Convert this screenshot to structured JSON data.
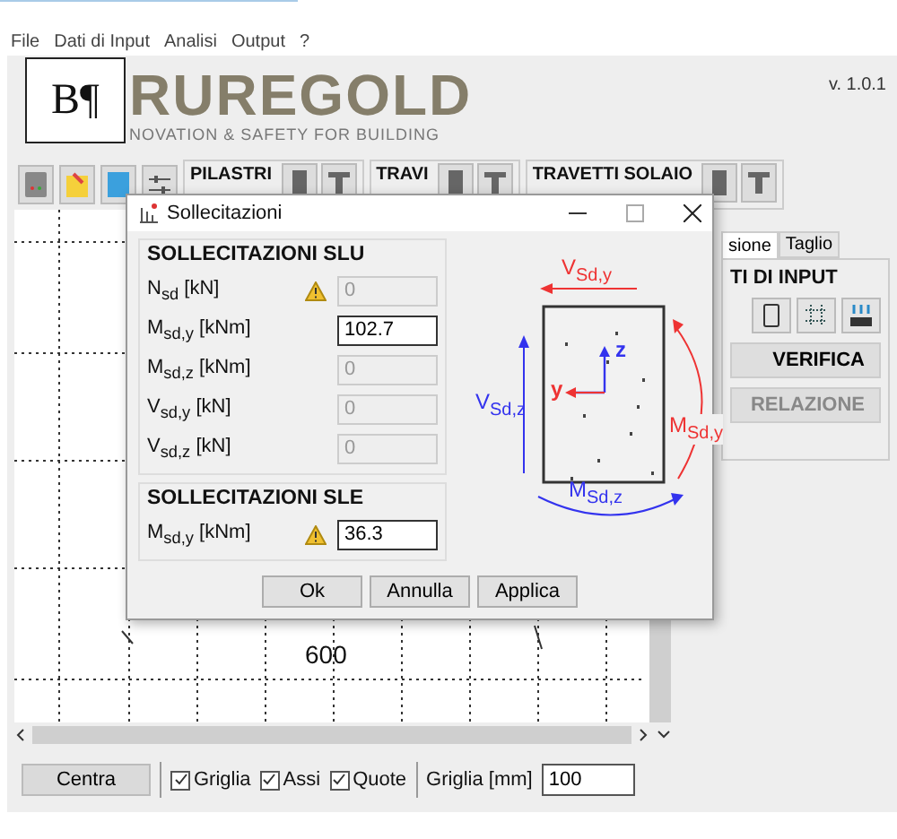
{
  "menu": [
    "File",
    "Dati di Input",
    "Analisi",
    "Output",
    "?"
  ],
  "overlay_mark": "B¶",
  "logo": {
    "name": "RUREGOLD",
    "tagline": "NOVATION & SAFETY FOR BUILDING"
  },
  "version": "v. 1.0.1",
  "toolbar_groups": [
    "PILASTRI",
    "TRAVI",
    "TRAVETTI SOLAIO"
  ],
  "canvas": {
    "dimension": "600"
  },
  "right_panel": {
    "tabs": [
      {
        "label": "sione",
        "selected": true
      },
      {
        "label": "Taglio",
        "selected": false
      }
    ],
    "group_title": "TI DI INPUT",
    "actions": [
      {
        "label": "VERIFICA",
        "disabled": false
      },
      {
        "label": "RELAZIONE",
        "disabled": true
      }
    ]
  },
  "bottom_bar": {
    "button": "Centra",
    "checkboxes": [
      {
        "label": "Griglia",
        "checked": true
      },
      {
        "label": "Assi",
        "checked": true
      },
      {
        "label": "Quote",
        "checked": true
      }
    ],
    "grid_label": "Griglia [mm]",
    "grid_value": "100"
  },
  "dialog": {
    "title": "Sollecitazioni",
    "sections": [
      {
        "title": "SOLLECITAZIONI SLU",
        "rows": [
          {
            "label": "N$_{sd}$ [kN]",
            "value": "0",
            "warning": true,
            "disabled": true
          },
          {
            "label": "M$_{sd,y}$ [kNm]",
            "value": "102.7",
            "warning": false,
            "disabled": false
          },
          {
            "label": "M$_{sd,z}$ [kNm]",
            "value": "0",
            "warning": false,
            "disabled": true
          },
          {
            "label": "V$_{sd,y}$ [kN]",
            "value": "0",
            "warning": false,
            "disabled": true
          },
          {
            "label": "V$_{sd,z}$ [kN]",
            "value": "0",
            "warning": false,
            "disabled": true
          }
        ]
      },
      {
        "title": "SOLLECITAZIONI SLE",
        "rows": [
          {
            "label": "M$_{sd,y}$ [kNm]",
            "value": "36.3",
            "warning": true,
            "disabled": false
          }
        ]
      }
    ],
    "diagram": {
      "v_y": "V$_{Sd,y}$",
      "v_z": "V$_{Sd,z}$",
      "m_y": "M$_{Sd,y}$",
      "m_z": "M$_{Sd,z}$",
      "axis_z": "z",
      "axis_y": "y"
    },
    "buttons": [
      "Ok",
      "Annulla",
      "Applica"
    ]
  }
}
